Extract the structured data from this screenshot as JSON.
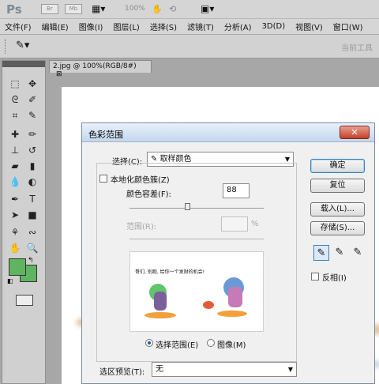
{
  "app": {
    "logo": "Ps",
    "mini_labels": [
      "Br",
      "Mb"
    ],
    "zoom_label": "100%",
    "workspace": "当前工具"
  },
  "menubar": {
    "items": [
      "文件(F)",
      "编辑(E)",
      "图像(I)",
      "图层(L)",
      "选择(S)",
      "滤镜(T)",
      "分析(A)",
      "3D(D)",
      "视图(V)",
      "窗口(W)"
    ]
  },
  "document": {
    "tab_label": "2.jpg @ 100%(RGB/8#)"
  },
  "toolbox": {
    "foreground_color": "#5fb55f",
    "background_color": "#5fb55f"
  },
  "dialog": {
    "title": "色彩范围",
    "close_glyph": "✕",
    "select_label": "选择(C):",
    "select_value": "取样颜色",
    "localized_label": "本地化颜色簇(Z)",
    "fuzziness_label": "颜色容差(F):",
    "fuzziness_value": "88",
    "range_label": "范围(R):",
    "range_unit": "%",
    "buttons": {
      "ok": "确定",
      "reset": "复位",
      "load": "载入(L)...",
      "save": "存储(S)..."
    },
    "invert_label": "反相(I)",
    "preview_text": "哥们, 别跑, 给你一个发财的机会!",
    "radio_selection": "选择范围(E)",
    "radio_image": "图像(M)",
    "selection_preview_label": "选区预览(T):",
    "selection_preview_value": "无"
  }
}
